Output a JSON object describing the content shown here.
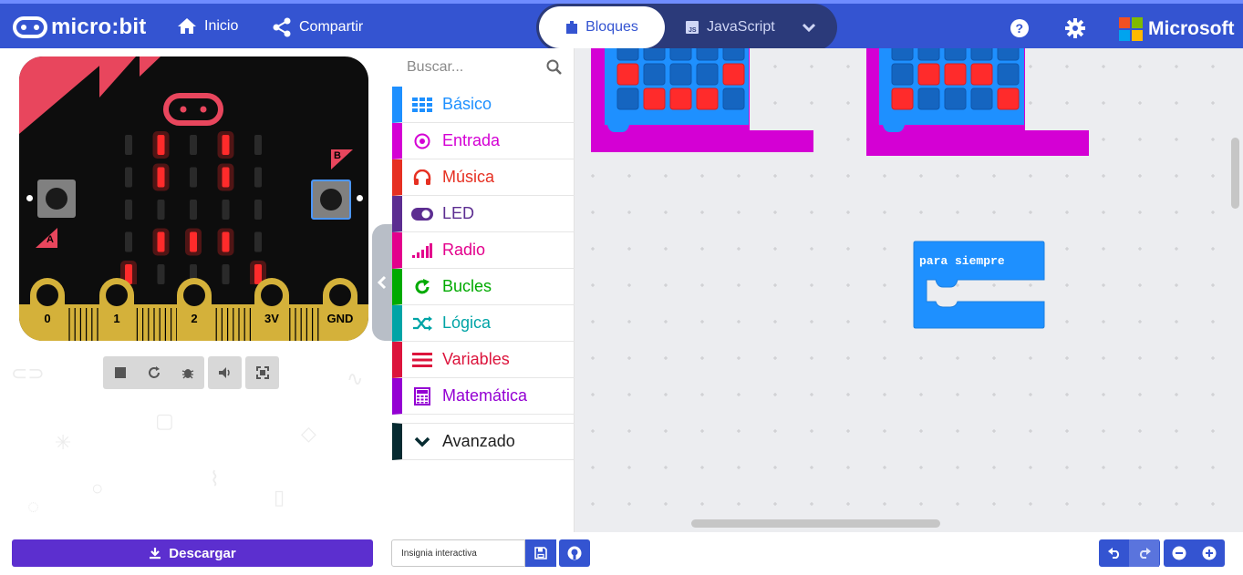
{
  "header": {
    "logo_text": "micro:bit",
    "home_label": "Inicio",
    "share_label": "Compartir",
    "tabs": [
      {
        "label": "Bloques",
        "active": true
      },
      {
        "label": "JavaScript",
        "active": false
      }
    ],
    "brand_label": "Microsoft"
  },
  "simulator": {
    "pins": [
      "0",
      "1",
      "2",
      "3V",
      "GND"
    ],
    "button_a_label": "A",
    "button_b_label": "B",
    "led_matrix": [
      [
        0,
        1,
        0,
        1,
        0
      ],
      [
        0,
        1,
        0,
        1,
        0
      ],
      [
        0,
        0,
        0,
        0,
        0
      ],
      [
        0,
        1,
        1,
        1,
        0
      ],
      [
        1,
        0,
        0,
        0,
        1
      ]
    ]
  },
  "toolbox": {
    "search_placeholder": "Buscar...",
    "categories": [
      {
        "label": "Básico",
        "color": "#1E90FF",
        "icon": "grid-icon"
      },
      {
        "label": "Entrada",
        "color": "#D400D4",
        "icon": "target-icon"
      },
      {
        "label": "Música",
        "color": "#E63022",
        "icon": "headphones-icon"
      },
      {
        "label": "LED",
        "color": "#5C2D91",
        "icon": "toggle-icon"
      },
      {
        "label": "Radio",
        "color": "#E3008C",
        "icon": "signal-bars-icon"
      },
      {
        "label": "Bucles",
        "color": "#00AA00",
        "icon": "refresh-icon"
      },
      {
        "label": "Lógica",
        "color": "#00A4A6",
        "icon": "shuffle-icon"
      },
      {
        "label": "Variables",
        "color": "#DC143C",
        "icon": "lines-icon"
      },
      {
        "label": "Matemática",
        "color": "#9400D3",
        "icon": "calculator-icon"
      }
    ],
    "advanced_label": "Avanzado"
  },
  "workspace": {
    "forever_block_label": "para siempre"
  },
  "footer": {
    "download_label": "Descargar",
    "project_name": "Insignia interactiva"
  },
  "colors": {
    "header": "#3454D1",
    "download": "#5C2FCF",
    "led_on": "#FF2B2B",
    "block_blue": "#1E90FF",
    "block_magenta": "#D400D4"
  }
}
